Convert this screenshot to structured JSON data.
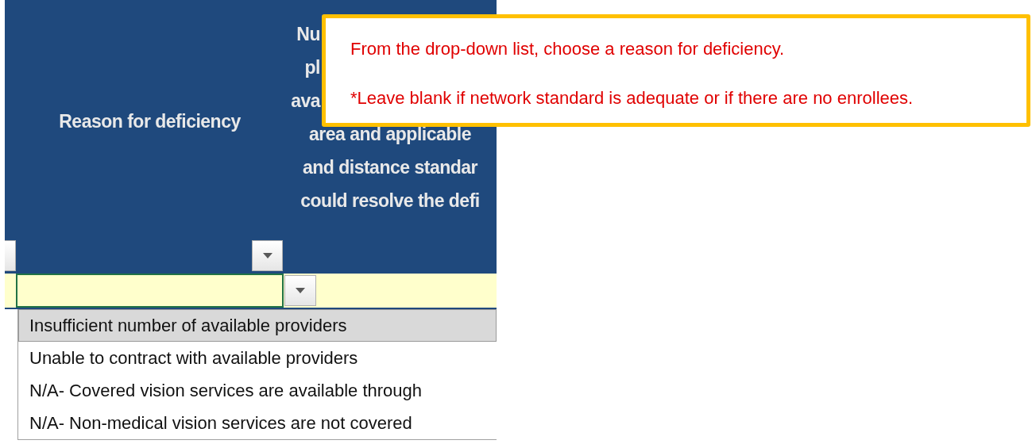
{
  "header": {
    "column_2": {
      "title": "Reason for deficiency"
    },
    "column_3": {
      "lines_beside_callout": [
        "Nu",
        "pl",
        "ava"
      ],
      "lines_below_callout": [
        "area and applicable",
        "and distance standar",
        "could resolve the defi"
      ]
    }
  },
  "callout": {
    "lines": [
      "From the drop-down list, choose a reason for deficiency.",
      "*Leave blank if network standard is adequate or if there are no enrollees."
    ]
  },
  "dropdown": {
    "items": [
      {
        "label": "Insufficient number of available providers",
        "selected": true
      },
      {
        "label": "Unable to contract with available providers",
        "selected": false
      },
      {
        "label": "N/A- Covered vision services are available through",
        "selected": false
      },
      {
        "label": "N/A- Non-medical vision services are not covered",
        "selected": false
      }
    ]
  }
}
